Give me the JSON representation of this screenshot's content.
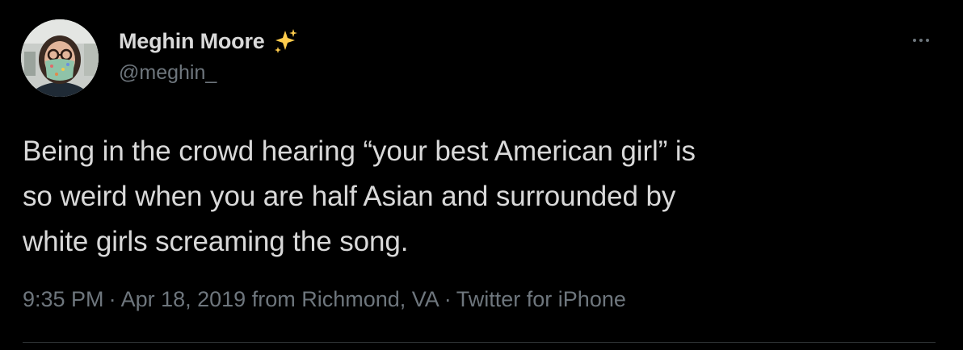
{
  "tweet": {
    "author": {
      "display_name": "Meghin Moore",
      "handle": "@meghin_",
      "name_emoji": "sparkles-icon"
    },
    "text_lines": [
      "Being in the crowd hearing “your best American girl” is",
      "so weird when you are half Asian and surrounded by",
      "white girls screaming the song."
    ],
    "timestamp": "9:35 PM",
    "date": "Apr 18, 2019",
    "location": "from Richmond, VA",
    "source": "Twitter for iPhone",
    "separator": "·",
    "more_icon": "ellipsis-icon"
  },
  "colors": {
    "background": "#000000",
    "primary_text": "#d9d9d9",
    "secondary_text": "#6e767d",
    "divider": "#2f3336",
    "sparkle": "#ffcc4d"
  }
}
